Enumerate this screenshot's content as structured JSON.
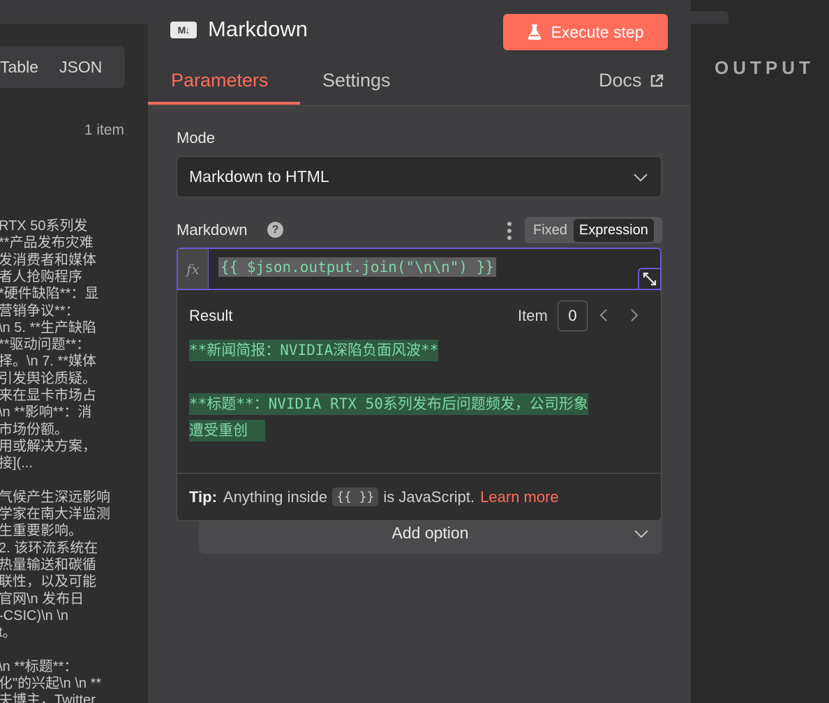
{
  "input_panel": {
    "view_tabs": [
      "Table",
      "JSON"
    ],
    "items_count": "1 item",
    "text_lines": [
      "RTX 50系列发",
      "**产品发布灾难",
      "发消费者和媒体",
      "者人抢购程序",
      "*硬件缺陷**：显",
      "营销争议**：",
      "\\n 5. **生产缺陷",
      "**驱动问题**：",
      "择。\\n 7. **媒体",
      "引发舆论质疑。",
      "来在显卡市场占",
      "\\n **影响**：消",
      "市场份额。",
      "用或解决方案，",
      "接](...",
      "",
      "气候产生深远影响",
      "学家在南大洋监测",
      "生重要影响。",
      "2. 该环流系统在",
      "热量输送和碳循",
      "联性，以及可能",
      "官网\\n 发布日",
      "-CSIC)\\n \\n",
      "t。",
      "",
      "\\n **标题**：",
      "化\"的兴起\\n \\n **",
      "夫博主，Twitter"
    ]
  },
  "node": {
    "title": "Markdown",
    "icon": "markdown-icon",
    "execute_label": "Execute step",
    "tabs": {
      "parameters": "Parameters",
      "settings": "Settings",
      "docs": "Docs"
    },
    "mode": {
      "label": "Mode",
      "value": "Markdown to HTML"
    },
    "markdown": {
      "label": "Markdown",
      "toggle_fixed": "Fixed",
      "toggle_expression": "Expression",
      "fx": "fx",
      "expression": "{{ $json.output.join(\"\\n\\n\") }}"
    },
    "result": {
      "label": "Result",
      "item_label": "Item",
      "item_index": "0",
      "lines": [
        "**新闻简报：NVIDIA深陷负面风波**",
        "**标题**：NVIDIA RTX 50系列发布后问题频发，公司形象",
        "遭受重创  "
      ]
    },
    "tip": {
      "prefix": "Tip:",
      "text_before": "Anything inside",
      "code": "{{ }}",
      "text_after": "is JavaScript.",
      "link": "Learn more"
    },
    "add_option": "Add option"
  },
  "output_panel": {
    "label": "OUTPUT"
  },
  "colors": {
    "accent": "#ff6d5a",
    "expression_border": "#6b5bd6",
    "result_text": "#7dd8a6"
  }
}
